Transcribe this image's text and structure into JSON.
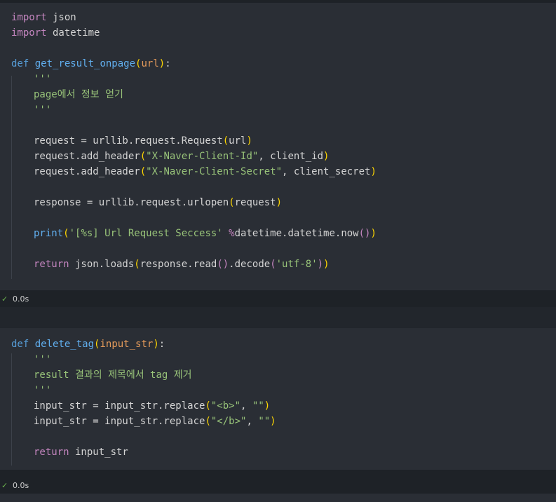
{
  "cell1": {
    "lines": {
      "l1_kw": "import",
      "l1_rest": " json",
      "l2_kw": "import",
      "l2_rest": " datetime",
      "l4_def": "def",
      "l4_fn": "get_result_onpage",
      "l4_p1": "(",
      "l4_param": "url",
      "l4_p2": ")",
      "l4_colon": ":",
      "l5_doc": "'''",
      "l6_doc": "page에서 정보 얻기",
      "l7_doc": "'''",
      "l9": "request = urllib.request.Request",
      "l9_p1": "(",
      "l9_arg": "url",
      "l9_p2": ")",
      "l10_a": "request.add_header",
      "l10_p1": "(",
      "l10_str": "\"X-Naver-Client-Id\"",
      "l10_b": ", client_id",
      "l10_p2": ")",
      "l11_a": "request.add_header",
      "l11_p1": "(",
      "l11_str": "\"X-Naver-Client-Secret\"",
      "l11_b": ", client_secret",
      "l11_p2": ")",
      "l13_a": "response = urllib.request.urlopen",
      "l13_p1": "(",
      "l13_arg": "request",
      "l13_p2": ")",
      "l15_fn": "print",
      "l15_p1": "(",
      "l15_str": "'[%s] Url Request Seccess'",
      "l15_op": " %",
      "l15_b": "datetime.datetime.now",
      "l15_p2": "()",
      "l15_p3": ")",
      "l17_kw": "return",
      "l17_a": " json.loads",
      "l17_p1": "(",
      "l17_b": "response.read",
      "l17_p2": "()",
      "l17_c": ".decode",
      "l17_p3": "(",
      "l17_str": "'utf-8'",
      "l17_p4": ")",
      "l17_p5": ")"
    },
    "status": {
      "check": "✓",
      "time": "0.0s"
    }
  },
  "cell2": {
    "lines": {
      "l1_def": "def",
      "l1_fn": "delete_tag",
      "l1_p1": "(",
      "l1_param": "input_str",
      "l1_p2": ")",
      "l1_colon": ":",
      "l2_doc": "'''",
      "l3_doc": "result 결과의 제목에서 tag 제거",
      "l4_doc": "'''",
      "l5_a": "input_str = input_str.replace",
      "l5_p1": "(",
      "l5_s1": "\"<b>\"",
      "l5_b": ", ",
      "l5_s2": "\"\"",
      "l5_p2": ")",
      "l6_a": "input_str = input_str.replace",
      "l6_p1": "(",
      "l6_s1": "\"</b>\"",
      "l6_b": ", ",
      "l6_s2": "\"\"",
      "l6_p2": ")",
      "l8_kw": "return",
      "l8_a": " input_str"
    },
    "status": {
      "check": "✓",
      "time": "0.0s"
    }
  },
  "colors": {
    "background": "#1e2227",
    "cell": "#2a2e35",
    "keyword": "#c586c0",
    "function": "#61afef",
    "string": "#98c379",
    "parameter": "#e59b5b",
    "bracket": "#ffd700"
  }
}
